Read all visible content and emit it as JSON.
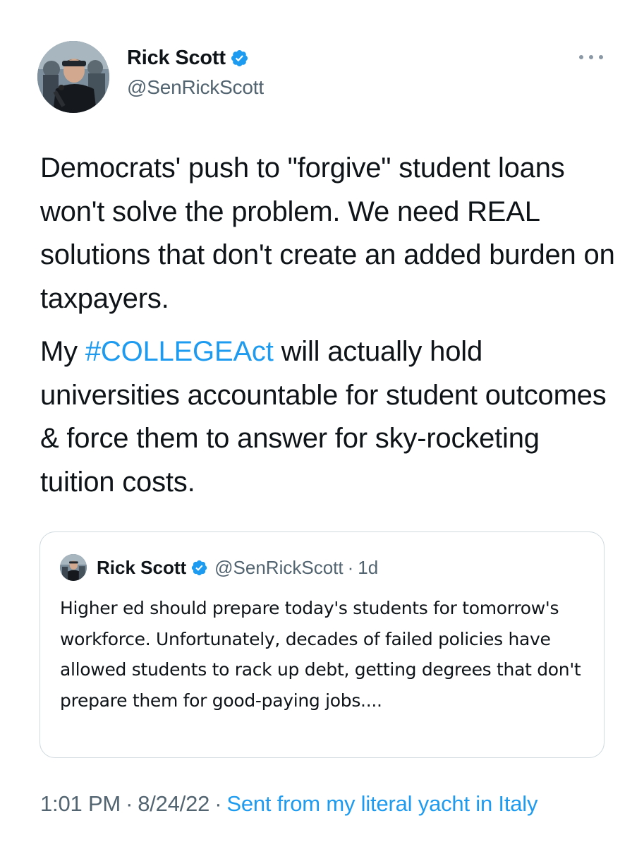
{
  "tweet": {
    "author": {
      "display_name": "Rick Scott",
      "handle": "@SenRickScott",
      "verified": true,
      "avatar_icon": "profile-photo"
    },
    "more_icon": "more-options-icon",
    "paragraphs": [
      {
        "parts": [
          {
            "text": "Democrats' push to \"forgive\" student loans won't solve the problem. We need REAL solutions that don't create an added burden on taxpayers.",
            "type": "text"
          }
        ]
      },
      {
        "parts": [
          {
            "text": "My ",
            "type": "text"
          },
          {
            "text": "#COLLEGEAct",
            "type": "hashtag"
          },
          {
            "text": " will actually hold universities accountable for student outcomes & force them to answer for sky-rocketing tuition costs.",
            "type": "text"
          }
        ]
      }
    ],
    "quoted_tweet": {
      "display_name": "Rick Scott",
      "handle": "@SenRickScott",
      "separator": "·",
      "time": "1d",
      "text": "Higher ed should prepare today's students for tomorrow's workforce. Unfortunately, decades of failed policies have allowed students to rack up debt, getting degrees that don't prepare them for good-paying jobs...."
    },
    "meta": {
      "time": "1:01 PM",
      "separator": "·",
      "date": "8/24/22",
      "separator2": "·",
      "source": "Sent from my literal yacht in Italy"
    }
  },
  "colors": {
    "accent": "#1d9bf0",
    "secondary_text": "#536471",
    "primary_text": "#0f1419",
    "border": "#cfd9de"
  }
}
